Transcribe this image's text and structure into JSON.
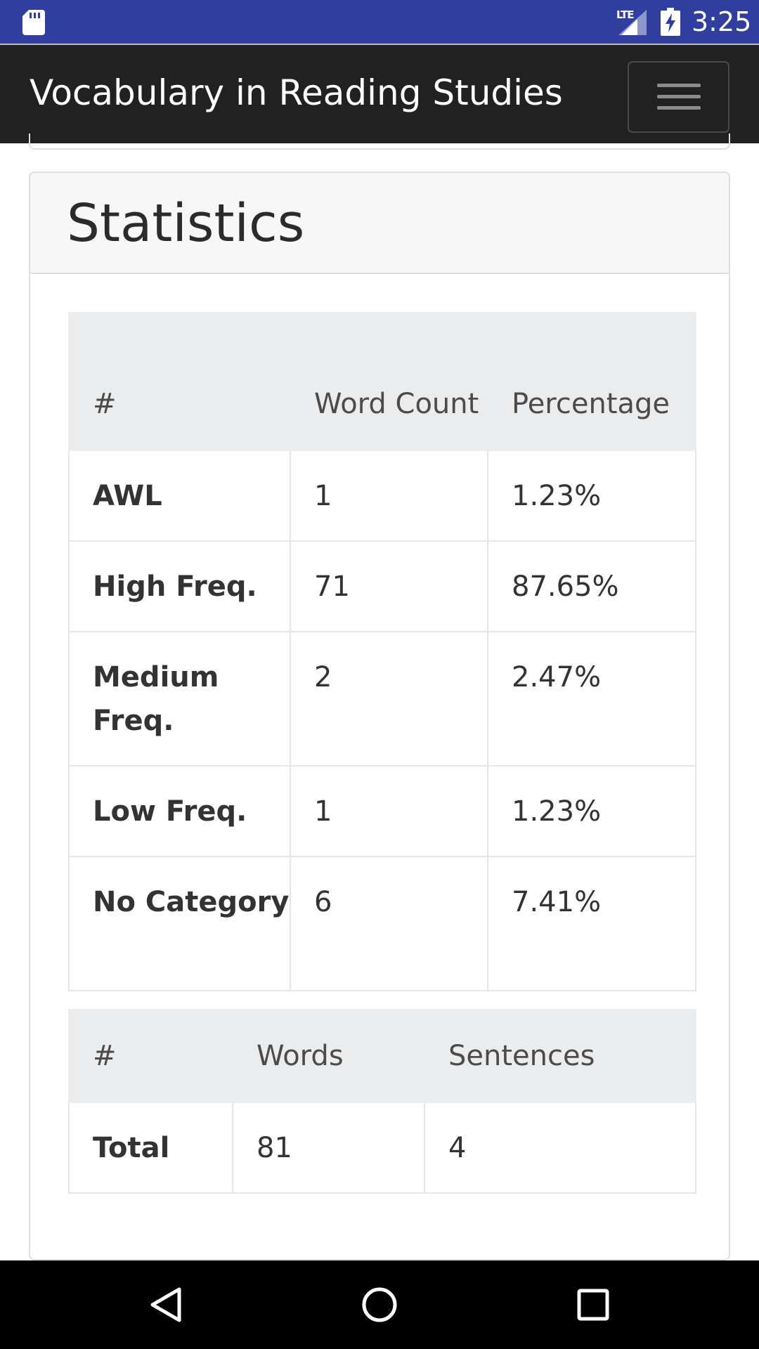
{
  "status_bar": {
    "network": "LTE",
    "time": "3:25",
    "icons": [
      "sd-card-icon",
      "signal-icon",
      "battery-charging-icon"
    ]
  },
  "navbar": {
    "brand": "Vocabulary in Reading Studies",
    "toggler_icon": "hamburger-menu-icon"
  },
  "statistics": {
    "title": "Statistics",
    "category_table": {
      "headers": [
        "#",
        "Word Count",
        "Percentage"
      ],
      "rows": [
        {
          "category": "AWL",
          "word_count": "1",
          "percentage": "1.23%"
        },
        {
          "category": "High Freq.",
          "word_count": "71",
          "percentage": "87.65%"
        },
        {
          "category": "Medium Freq.",
          "word_count": "2",
          "percentage": "2.47%"
        },
        {
          "category": "Low Freq.",
          "word_count": "1",
          "percentage": "1.23%"
        },
        {
          "category": "No Category",
          "word_count": "6",
          "percentage": "7.41%"
        }
      ]
    },
    "totals_table": {
      "headers": [
        "#",
        "Words",
        "Sentences"
      ],
      "rows": [
        {
          "label": "Total",
          "words": "81",
          "sentences": "4"
        }
      ]
    }
  },
  "nav_bar": {
    "buttons": [
      "back-icon",
      "home-icon",
      "recents-icon"
    ]
  },
  "colors": {
    "status_bar": "#303f9f",
    "navbar": "#212121",
    "card_header": "#f7f7f8",
    "table_header": "#ebecee",
    "border": "#dfdfdf",
    "system_nav": "#000000"
  }
}
